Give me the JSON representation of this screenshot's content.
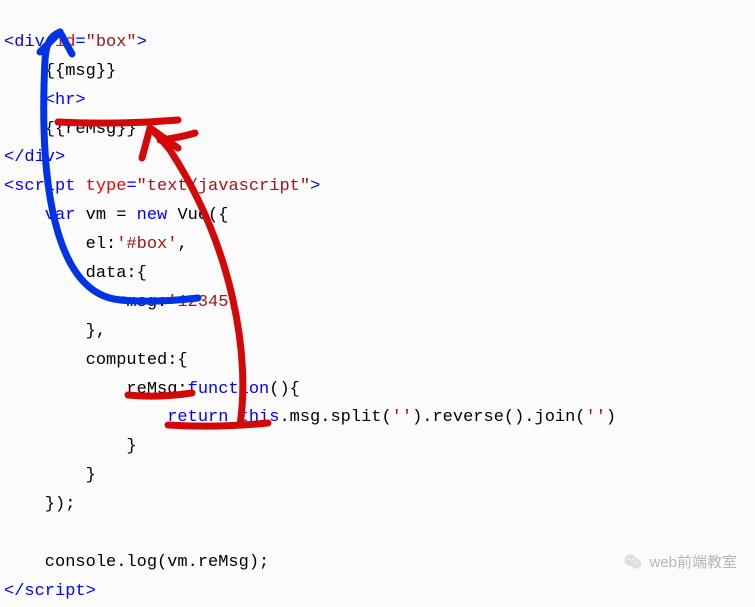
{
  "code": {
    "l01_a": "<div",
    "l01_b": " id",
    "l01_c": "=",
    "l01_d": "\"box\"",
    "l01_e": ">",
    "l02": "    {{msg}}",
    "l03_a": "    <hr>",
    "l04": "    {{reMsg}}",
    "l05_a": "</div>",
    "l06_a": "<script",
    "l06_b": " type",
    "l06_c": "=",
    "l06_d": "\"text/javascript\"",
    "l06_e": ">",
    "l07_a": "    var",
    "l07_b": " vm = ",
    "l07_c": "new",
    "l07_d": " Vue({",
    "l08_a": "        el:",
    "l08_b": "'#box'",
    "l08_c": ",",
    "l09": "        data:{",
    "l10_a": "            msg:",
    "l10_b": "'12345'",
    "l11": "        },",
    "l12": "        computed:{",
    "l13_a": "            reMsg:",
    "l13_b": "function",
    "l13_c": "(){",
    "l14_a": "                return",
    "l14_b": " this",
    "l14_c": ".msg.split(",
    "l14_d": "''",
    "l14_e": ").reverse().join(",
    "l14_f": "''",
    "l14_g": ")",
    "l15": "            }",
    "l16": "        }",
    "l17": "    });",
    "l18": "",
    "l19": "    console.log(vm.reMsg);",
    "l20_a": "</",
    "l20_b": "script",
    "l20_c": ">"
  },
  "watermark_text": "web前端教室",
  "annotation_colors": {
    "blue": "#0033e6",
    "red": "#d30808"
  }
}
